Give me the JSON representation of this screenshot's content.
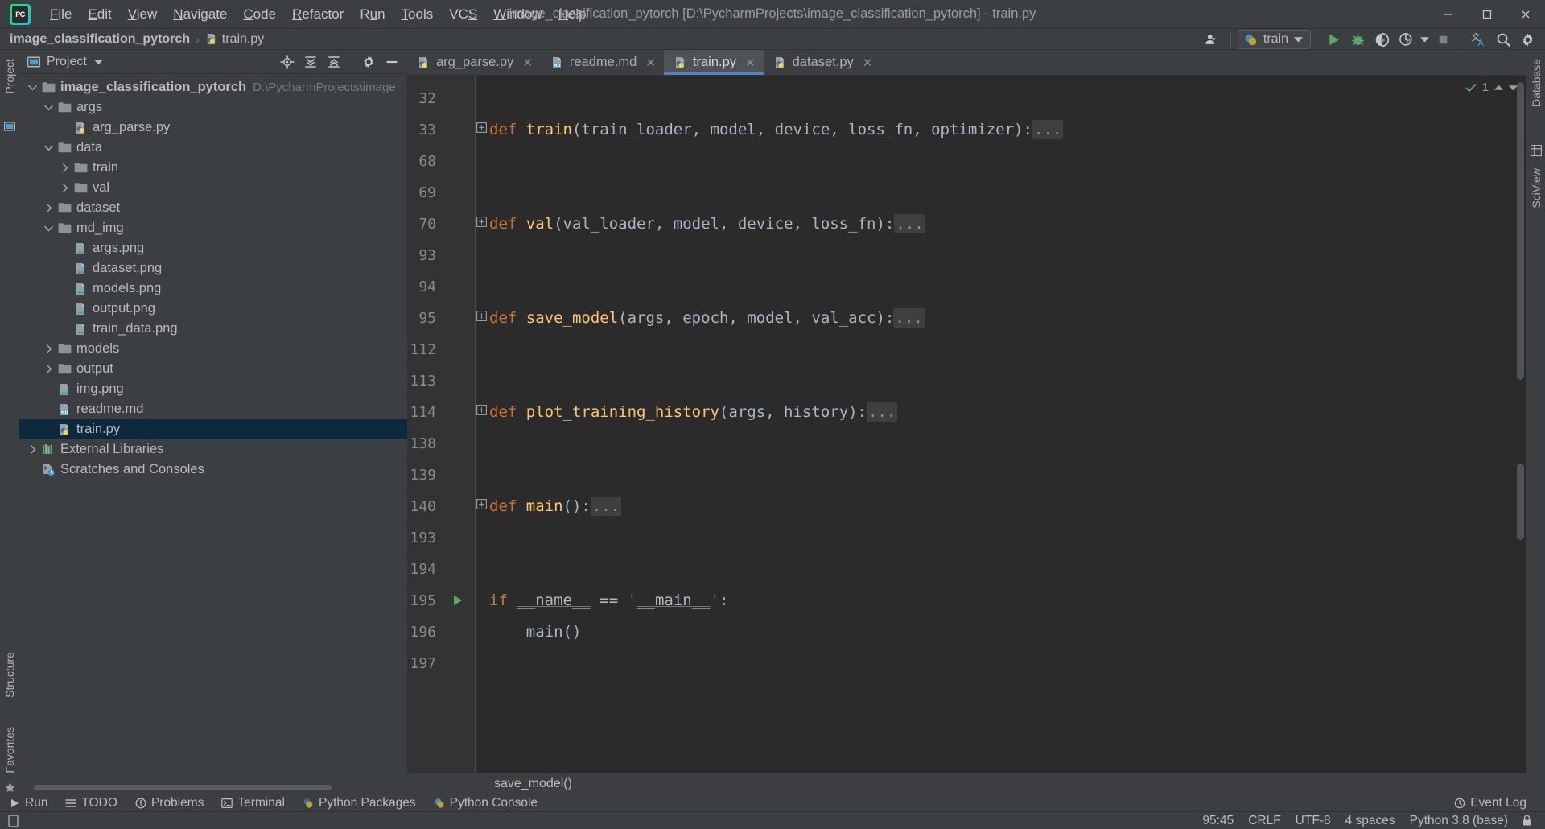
{
  "window": {
    "title": "image_classification_pytorch [D:\\PycharmProjects\\image_classification_pytorch] - train.py",
    "minimize": "—",
    "maximize": "❐",
    "close": "✕"
  },
  "menu": [
    {
      "label": "File"
    },
    {
      "label": "Edit"
    },
    {
      "label": "View"
    },
    {
      "label": "Navigate"
    },
    {
      "label": "Code"
    },
    {
      "label": "Refactor"
    },
    {
      "label": "Run"
    },
    {
      "label": "Tools"
    },
    {
      "label": "VCS"
    },
    {
      "label": "Window"
    },
    {
      "label": "Help"
    }
  ],
  "navbar": {
    "crumbs": [
      "image_classification_pytorch",
      "train.py"
    ],
    "separator": "›"
  },
  "toolbar": {
    "run_config": "train",
    "icons": [
      "user-account-icon",
      "run-icon",
      "debug-icon",
      "coverage-icon",
      "profile-icon",
      "stop-icon",
      "translate-icon",
      "search-everywhere-icon",
      "settings-icon"
    ]
  },
  "stripes": {
    "left_top": "Project",
    "left_bottom": [
      "Structure",
      "Favorites"
    ],
    "right": [
      "Database",
      "SciView"
    ]
  },
  "project": {
    "header_title": "Project",
    "header_icons": [
      "locate-icon",
      "expand-all-icon",
      "collapse-all-icon",
      "gear-icon",
      "hide-icon"
    ],
    "tree": [
      {
        "indent": 0,
        "arrow": "v",
        "icon": "folder-root-icon",
        "name": "image_classification_pytorch",
        "bold": true,
        "path": "D:\\PycharmProjects\\image_",
        "selected": false
      },
      {
        "indent": 1,
        "arrow": "v",
        "icon": "folder-icon",
        "name": "args",
        "bold": false,
        "path": "",
        "selected": false
      },
      {
        "indent": 2,
        "arrow": "",
        "icon": "python-file-icon",
        "name": "arg_parse.py",
        "bold": false,
        "path": "",
        "selected": false
      },
      {
        "indent": 1,
        "arrow": "v",
        "icon": "folder-icon",
        "name": "data",
        "bold": false,
        "path": "",
        "selected": false
      },
      {
        "indent": 2,
        "arrow": ">",
        "icon": "folder-icon",
        "name": "train",
        "bold": false,
        "path": "",
        "selected": false
      },
      {
        "indent": 2,
        "arrow": ">",
        "icon": "folder-icon",
        "name": "val",
        "bold": false,
        "path": "",
        "selected": false
      },
      {
        "indent": 1,
        "arrow": ">",
        "icon": "folder-icon",
        "name": "dataset",
        "bold": false,
        "path": "",
        "selected": false
      },
      {
        "indent": 1,
        "arrow": "v",
        "icon": "folder-icon",
        "name": "md_img",
        "bold": false,
        "path": "",
        "selected": false
      },
      {
        "indent": 2,
        "arrow": "",
        "icon": "image-file-icon",
        "name": "args.png",
        "bold": false,
        "path": "",
        "selected": false
      },
      {
        "indent": 2,
        "arrow": "",
        "icon": "image-file-icon",
        "name": "dataset.png",
        "bold": false,
        "path": "",
        "selected": false
      },
      {
        "indent": 2,
        "arrow": "",
        "icon": "image-file-icon",
        "name": "models.png",
        "bold": false,
        "path": "",
        "selected": false
      },
      {
        "indent": 2,
        "arrow": "",
        "icon": "image-file-icon",
        "name": "output.png",
        "bold": false,
        "path": "",
        "selected": false
      },
      {
        "indent": 2,
        "arrow": "",
        "icon": "image-file-icon",
        "name": "train_data.png",
        "bold": false,
        "path": "",
        "selected": false
      },
      {
        "indent": 1,
        "arrow": ">",
        "icon": "folder-icon",
        "name": "models",
        "bold": false,
        "path": "",
        "selected": false
      },
      {
        "indent": 1,
        "arrow": ">",
        "icon": "folder-icon",
        "name": "output",
        "bold": false,
        "path": "",
        "selected": false
      },
      {
        "indent": 1,
        "arrow": "",
        "icon": "image-file-icon",
        "name": "img.png",
        "bold": false,
        "path": "",
        "selected": false
      },
      {
        "indent": 1,
        "arrow": "",
        "icon": "markdown-file-icon",
        "name": "readme.md",
        "bold": false,
        "path": "",
        "selected": false
      },
      {
        "indent": 1,
        "arrow": "",
        "icon": "python-file-icon",
        "name": "train.py",
        "bold": false,
        "path": "",
        "selected": true
      },
      {
        "indent": 0,
        "arrow": ">",
        "icon": "libraries-icon",
        "name": "External Libraries",
        "bold": false,
        "path": "",
        "selected": false
      },
      {
        "indent": 0,
        "arrow": "",
        "icon": "scratches-icon",
        "name": "Scratches and Consoles",
        "bold": false,
        "path": "",
        "selected": false
      }
    ]
  },
  "editor": {
    "tabs": [
      {
        "label": "arg_parse.py",
        "icon": "python-file-icon",
        "active": false,
        "close": "✕"
      },
      {
        "label": "readme.md",
        "icon": "markdown-file-icon",
        "active": false,
        "close": "✕"
      },
      {
        "label": "train.py",
        "icon": "python-file-icon",
        "active": true,
        "close": "✕"
      },
      {
        "label": "dataset.py",
        "icon": "python-file-icon",
        "active": false,
        "close": "✕"
      }
    ],
    "inspection_count": "1",
    "breadcrumb": "save_model()",
    "lines": [
      {
        "num": "32",
        "fold": "",
        "run": false,
        "tokens": []
      },
      {
        "num": "33",
        "fold": "⊞",
        "run": false,
        "tokens": [
          {
            "t": "def ",
            "c": "kw"
          },
          {
            "t": "train",
            "c": "fn"
          },
          {
            "t": "(train_loader, model, device, loss_fn, optimizer):",
            "c": "id"
          },
          {
            "t": "...",
            "c": "ellip"
          }
        ]
      },
      {
        "num": "68",
        "fold": "",
        "run": false,
        "tokens": []
      },
      {
        "num": "69",
        "fold": "",
        "run": false,
        "tokens": []
      },
      {
        "num": "70",
        "fold": "⊞",
        "run": false,
        "tokens": [
          {
            "t": "def ",
            "c": "kw"
          },
          {
            "t": "val",
            "c": "fn"
          },
          {
            "t": "(val_loader, model, device, loss_fn):",
            "c": "id"
          },
          {
            "t": "...",
            "c": "ellip"
          }
        ]
      },
      {
        "num": "93",
        "fold": "",
        "run": false,
        "tokens": []
      },
      {
        "num": "94",
        "fold": "",
        "run": false,
        "tokens": []
      },
      {
        "num": "95",
        "fold": "⊞",
        "run": false,
        "caret": true,
        "tokens": [
          {
            "t": "def ",
            "c": "kw"
          },
          {
            "t": "save_model",
            "c": "fn"
          },
          {
            "t": "(args, epoch, model, val_acc):",
            "c": "id"
          },
          {
            "t": "CARET",
            "c": "caret"
          },
          {
            "t": "...",
            "c": "ellip"
          }
        ]
      },
      {
        "num": "112",
        "fold": "",
        "run": false,
        "tokens": []
      },
      {
        "num": "113",
        "fold": "",
        "run": false,
        "tokens": []
      },
      {
        "num": "114",
        "fold": "⊞",
        "run": false,
        "tokens": [
          {
            "t": "def ",
            "c": "kw"
          },
          {
            "t": "plot_training_history",
            "c": "fn"
          },
          {
            "t": "(args, history):",
            "c": "id"
          },
          {
            "t": "...",
            "c": "ellip"
          }
        ]
      },
      {
        "num": "138",
        "fold": "",
        "run": false,
        "tokens": []
      },
      {
        "num": "139",
        "fold": "",
        "run": false,
        "tokens": []
      },
      {
        "num": "140",
        "fold": "⊞",
        "run": false,
        "tokens": [
          {
            "t": "def ",
            "c": "kw"
          },
          {
            "t": "main",
            "c": "fn"
          },
          {
            "t": "():",
            "c": "id"
          },
          {
            "t": "...",
            "c": "ellip"
          }
        ]
      },
      {
        "num": "193",
        "fold": "",
        "run": false,
        "tokens": []
      },
      {
        "num": "194",
        "fold": "",
        "run": false,
        "tokens": []
      },
      {
        "num": "195",
        "fold": "",
        "run": true,
        "tokens": [
          {
            "t": "if ",
            "c": "kw"
          },
          {
            "t": "__name__",
            "c": "dunder"
          },
          {
            "t": " == ",
            "c": "id"
          },
          {
            "t": "'",
            "c": "str"
          },
          {
            "t": "__main__",
            "c": "str dunder"
          },
          {
            "t": "'",
            "c": "str"
          },
          {
            "t": ":",
            "c": "id"
          }
        ]
      },
      {
        "num": "196",
        "fold": "",
        "run": false,
        "tokens": [
          {
            "t": "    ",
            "c": "id"
          },
          {
            "t": "main",
            "c": "id"
          },
          {
            "t": "()",
            "c": "id"
          }
        ]
      },
      {
        "num": "197",
        "fold": "",
        "run": false,
        "tokens": []
      }
    ]
  },
  "bottom_tools": [
    {
      "label": "Run",
      "icon": "run-icon"
    },
    {
      "label": "TODO",
      "icon": "todo-icon"
    },
    {
      "label": "Problems",
      "icon": "problems-icon"
    },
    {
      "label": "Terminal",
      "icon": "terminal-icon"
    },
    {
      "label": "Python Packages",
      "icon": "packages-icon"
    },
    {
      "label": "Python Console",
      "icon": "console-icon"
    }
  ],
  "event_log": {
    "label": "Event Log",
    "icon": "event-log-icon"
  },
  "status": {
    "caret_position": "95:45",
    "line_separator": "CRLF",
    "encoding": "UTF-8",
    "indent": "4 spaces",
    "interpreter": "Python 3.8 (base)",
    "lock_icon": "lock-icon",
    "memory_icon": "memory-icon"
  },
  "colors": {
    "background": "#3c3f41",
    "editor_bg": "#2b2b2b",
    "gutter_bg": "#313335",
    "selection": "#0d293e",
    "tab_active": "#4e5254",
    "tab_underline": "#4a88c7",
    "keyword": "#cc7832",
    "function": "#ffc66d",
    "string": "#6a8759",
    "text": "#a9b7c6",
    "run_green": "#5ca85c"
  }
}
